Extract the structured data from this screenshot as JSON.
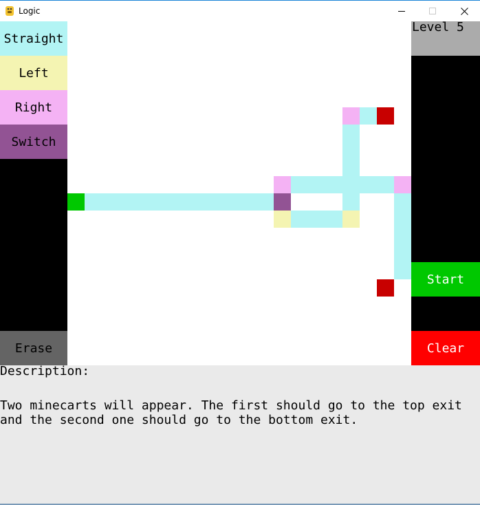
{
  "window": {
    "title": "Logic",
    "app_icon": "python-snake-icon",
    "minimize_glyph": "—",
    "maximize_glyph": "☐",
    "close_glyph": "✕"
  },
  "palette": {
    "straight": "#b2f4f4",
    "left": "#f4f4b2",
    "right": "#f4b2f4",
    "switch": "#925394",
    "start_tile": "#00c800",
    "exit_tile": "#c80000",
    "start_button": "#00c800",
    "clear_button": "#ff0000",
    "erase_button": "#646464",
    "level_box": "#ababab"
  },
  "tools": {
    "straight_label": "Straight",
    "left_label": "Left",
    "right_label": "Right",
    "switch_label": "Switch",
    "erase_label": "Erase"
  },
  "controls": {
    "level_label": "Level 5",
    "start_label": "Start",
    "clear_label": "Clear"
  },
  "description": {
    "heading": "Description:",
    "line1": "Two minecarts will appear. The first should go to the top exit",
    "line2": "and the second one should go to the bottom exit."
  },
  "grid_tiles": [
    {
      "col": 0,
      "row": 10,
      "kind": "start_tile"
    },
    {
      "col": 1,
      "row": 10,
      "kind": "straight"
    },
    {
      "col": 2,
      "row": 10,
      "kind": "straight"
    },
    {
      "col": 3,
      "row": 10,
      "kind": "straight"
    },
    {
      "col": 4,
      "row": 10,
      "kind": "straight"
    },
    {
      "col": 5,
      "row": 10,
      "kind": "straight"
    },
    {
      "col": 6,
      "row": 10,
      "kind": "straight"
    },
    {
      "col": 7,
      "row": 10,
      "kind": "straight"
    },
    {
      "col": 8,
      "row": 10,
      "kind": "straight"
    },
    {
      "col": 9,
      "row": 10,
      "kind": "straight"
    },
    {
      "col": 10,
      "row": 10,
      "kind": "straight"
    },
    {
      "col": 11,
      "row": 10,
      "kind": "straight"
    },
    {
      "col": 12,
      "row": 10,
      "kind": "switch"
    },
    {
      "col": 12,
      "row": 9,
      "kind": "right"
    },
    {
      "col": 13,
      "row": 9,
      "kind": "straight"
    },
    {
      "col": 14,
      "row": 9,
      "kind": "straight"
    },
    {
      "col": 15,
      "row": 9,
      "kind": "straight"
    },
    {
      "col": 16,
      "row": 9,
      "kind": "straight"
    },
    {
      "col": 17,
      "row": 9,
      "kind": "straight"
    },
    {
      "col": 18,
      "row": 9,
      "kind": "straight"
    },
    {
      "col": 19,
      "row": 9,
      "kind": "right"
    },
    {
      "col": 12,
      "row": 11,
      "kind": "left"
    },
    {
      "col": 13,
      "row": 11,
      "kind": "straight"
    },
    {
      "col": 14,
      "row": 11,
      "kind": "straight"
    },
    {
      "col": 15,
      "row": 11,
      "kind": "straight"
    },
    {
      "col": 16,
      "row": 11,
      "kind": "left"
    },
    {
      "col": 16,
      "row": 10,
      "kind": "straight"
    },
    {
      "col": 16,
      "row": 8,
      "kind": "straight"
    },
    {
      "col": 16,
      "row": 7,
      "kind": "straight"
    },
    {
      "col": 16,
      "row": 6,
      "kind": "straight"
    },
    {
      "col": 16,
      "row": 5,
      "kind": "right"
    },
    {
      "col": 17,
      "row": 5,
      "kind": "straight"
    },
    {
      "col": 18,
      "row": 5,
      "kind": "exit_tile"
    },
    {
      "col": 19,
      "row": 10,
      "kind": "straight"
    },
    {
      "col": 19,
      "row": 11,
      "kind": "straight"
    },
    {
      "col": 19,
      "row": 12,
      "kind": "straight"
    },
    {
      "col": 19,
      "row": 13,
      "kind": "straight"
    },
    {
      "col": 19,
      "row": 14,
      "kind": "straight"
    },
    {
      "col": 18,
      "row": 15,
      "kind": "exit_tile"
    }
  ]
}
